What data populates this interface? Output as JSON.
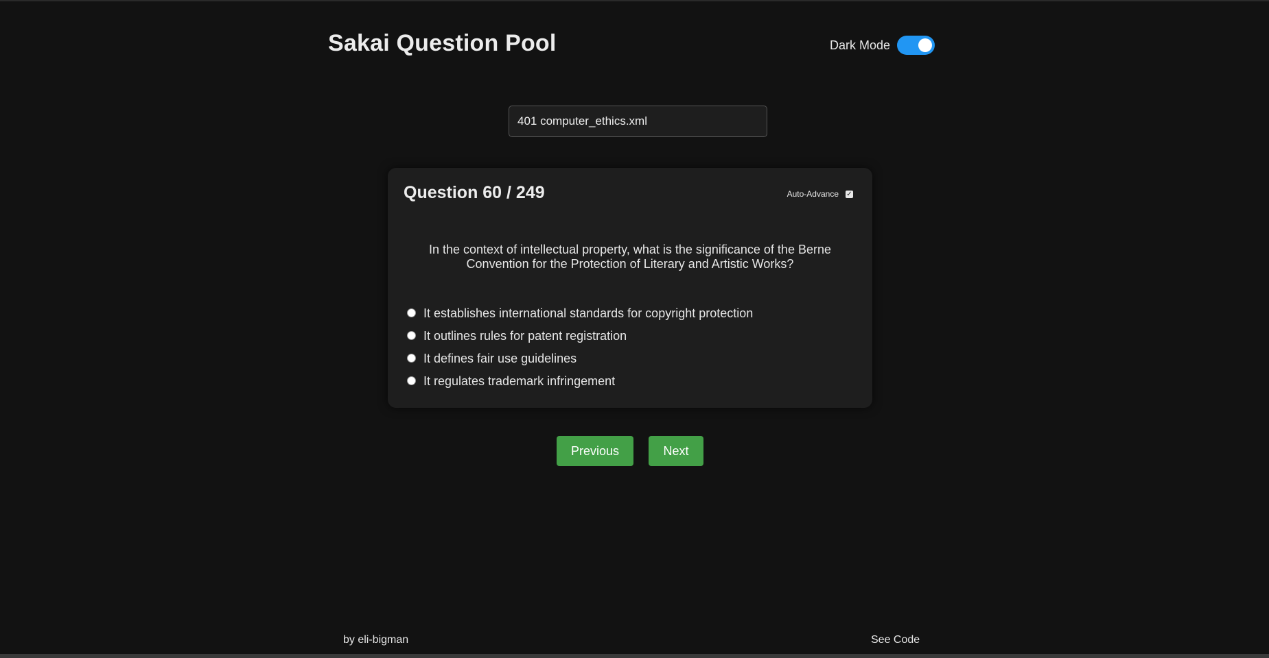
{
  "header": {
    "title": "Sakai Question Pool",
    "dark_mode_label": "Dark Mode",
    "dark_mode_on": true,
    "accent_color": "#2196f3"
  },
  "file_select": {
    "value": "401 computer_ethics.xml"
  },
  "question": {
    "heading": "Question 60 / 249",
    "auto_advance_label": "Auto-Advance",
    "auto_advance_checked": true,
    "text": "In the context of intellectual property, what is the significance of the Berne Convention for the Protection of Literary and Artistic Works?",
    "options": [
      {
        "label": "It establishes international standards for copyright protection"
      },
      {
        "label": "It outlines rules for patent registration"
      },
      {
        "label": "It defines fair use guidelines"
      },
      {
        "label": "It regulates trademark infringement"
      }
    ]
  },
  "nav": {
    "previous_label": "Previous",
    "next_label": "Next",
    "button_color": "#43a047"
  },
  "footer": {
    "author": "by eli-bigman",
    "code_link": "See Code"
  }
}
